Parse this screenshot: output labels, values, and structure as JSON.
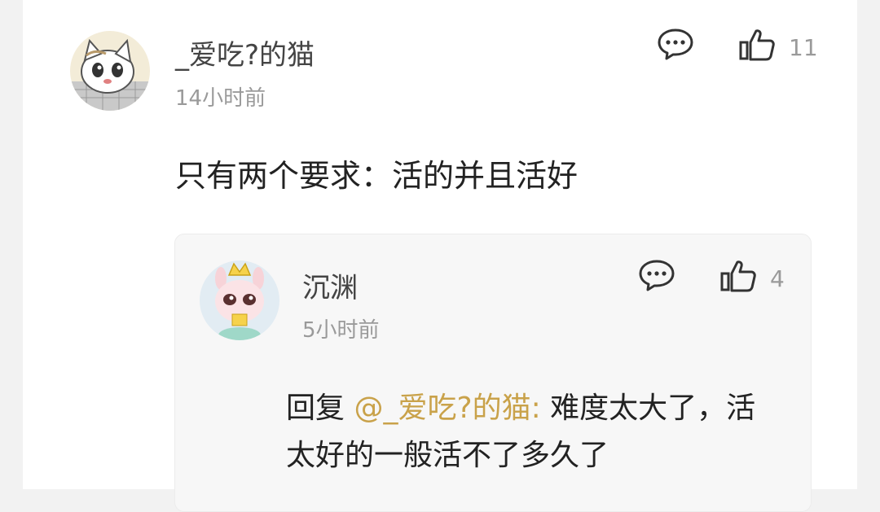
{
  "comment": {
    "username": "_爱吃?的猫",
    "time": "14小时前",
    "likes": "11",
    "text": "只有两个要求：活的并且活好",
    "avatar_icon": "cat-avatar-icon"
  },
  "reply": {
    "username": "沉渊",
    "time": "5小时前",
    "likes": "4",
    "prefix": "回复",
    "mention": "@_爱吃?的猫:",
    "text": "难度太大了，活太好的一般活不了多久了",
    "avatar_icon": "bunny-avatar-icon"
  },
  "colors": {
    "mention": "#c9a24a",
    "muted": "#9a9a9a"
  }
}
